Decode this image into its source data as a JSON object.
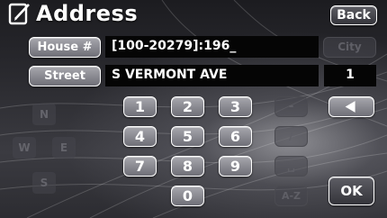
{
  "title": "Address",
  "back_label": "Back",
  "house_button_label": "House #",
  "house_number_value": "[100-20279]:196_",
  "city_button_label": "City",
  "street_button_label": "Street",
  "street_value": "S VERMONT AVE",
  "street_count": "1",
  "keypad": {
    "k1": "1",
    "k2": "2",
    "k3": "3",
    "k4": "4",
    "k5": "5",
    "k6": "6",
    "k7": "7",
    "k8": "8",
    "k9": "9",
    "k0": "0"
  },
  "symbols": {
    "dash": "-",
    "slash": "/",
    "space": "␣"
  },
  "backspace_icon": "left-arrow-icon",
  "az_label": "A-Z",
  "ok_label": "OK",
  "compass": {
    "n": "N",
    "w": "W",
    "e": "E",
    "s": "S"
  },
  "colors": {
    "screen_bg": "#2a2a2f",
    "button_face": "#8a8a92",
    "field_bg": "#050505",
    "text": "#ffffff"
  }
}
